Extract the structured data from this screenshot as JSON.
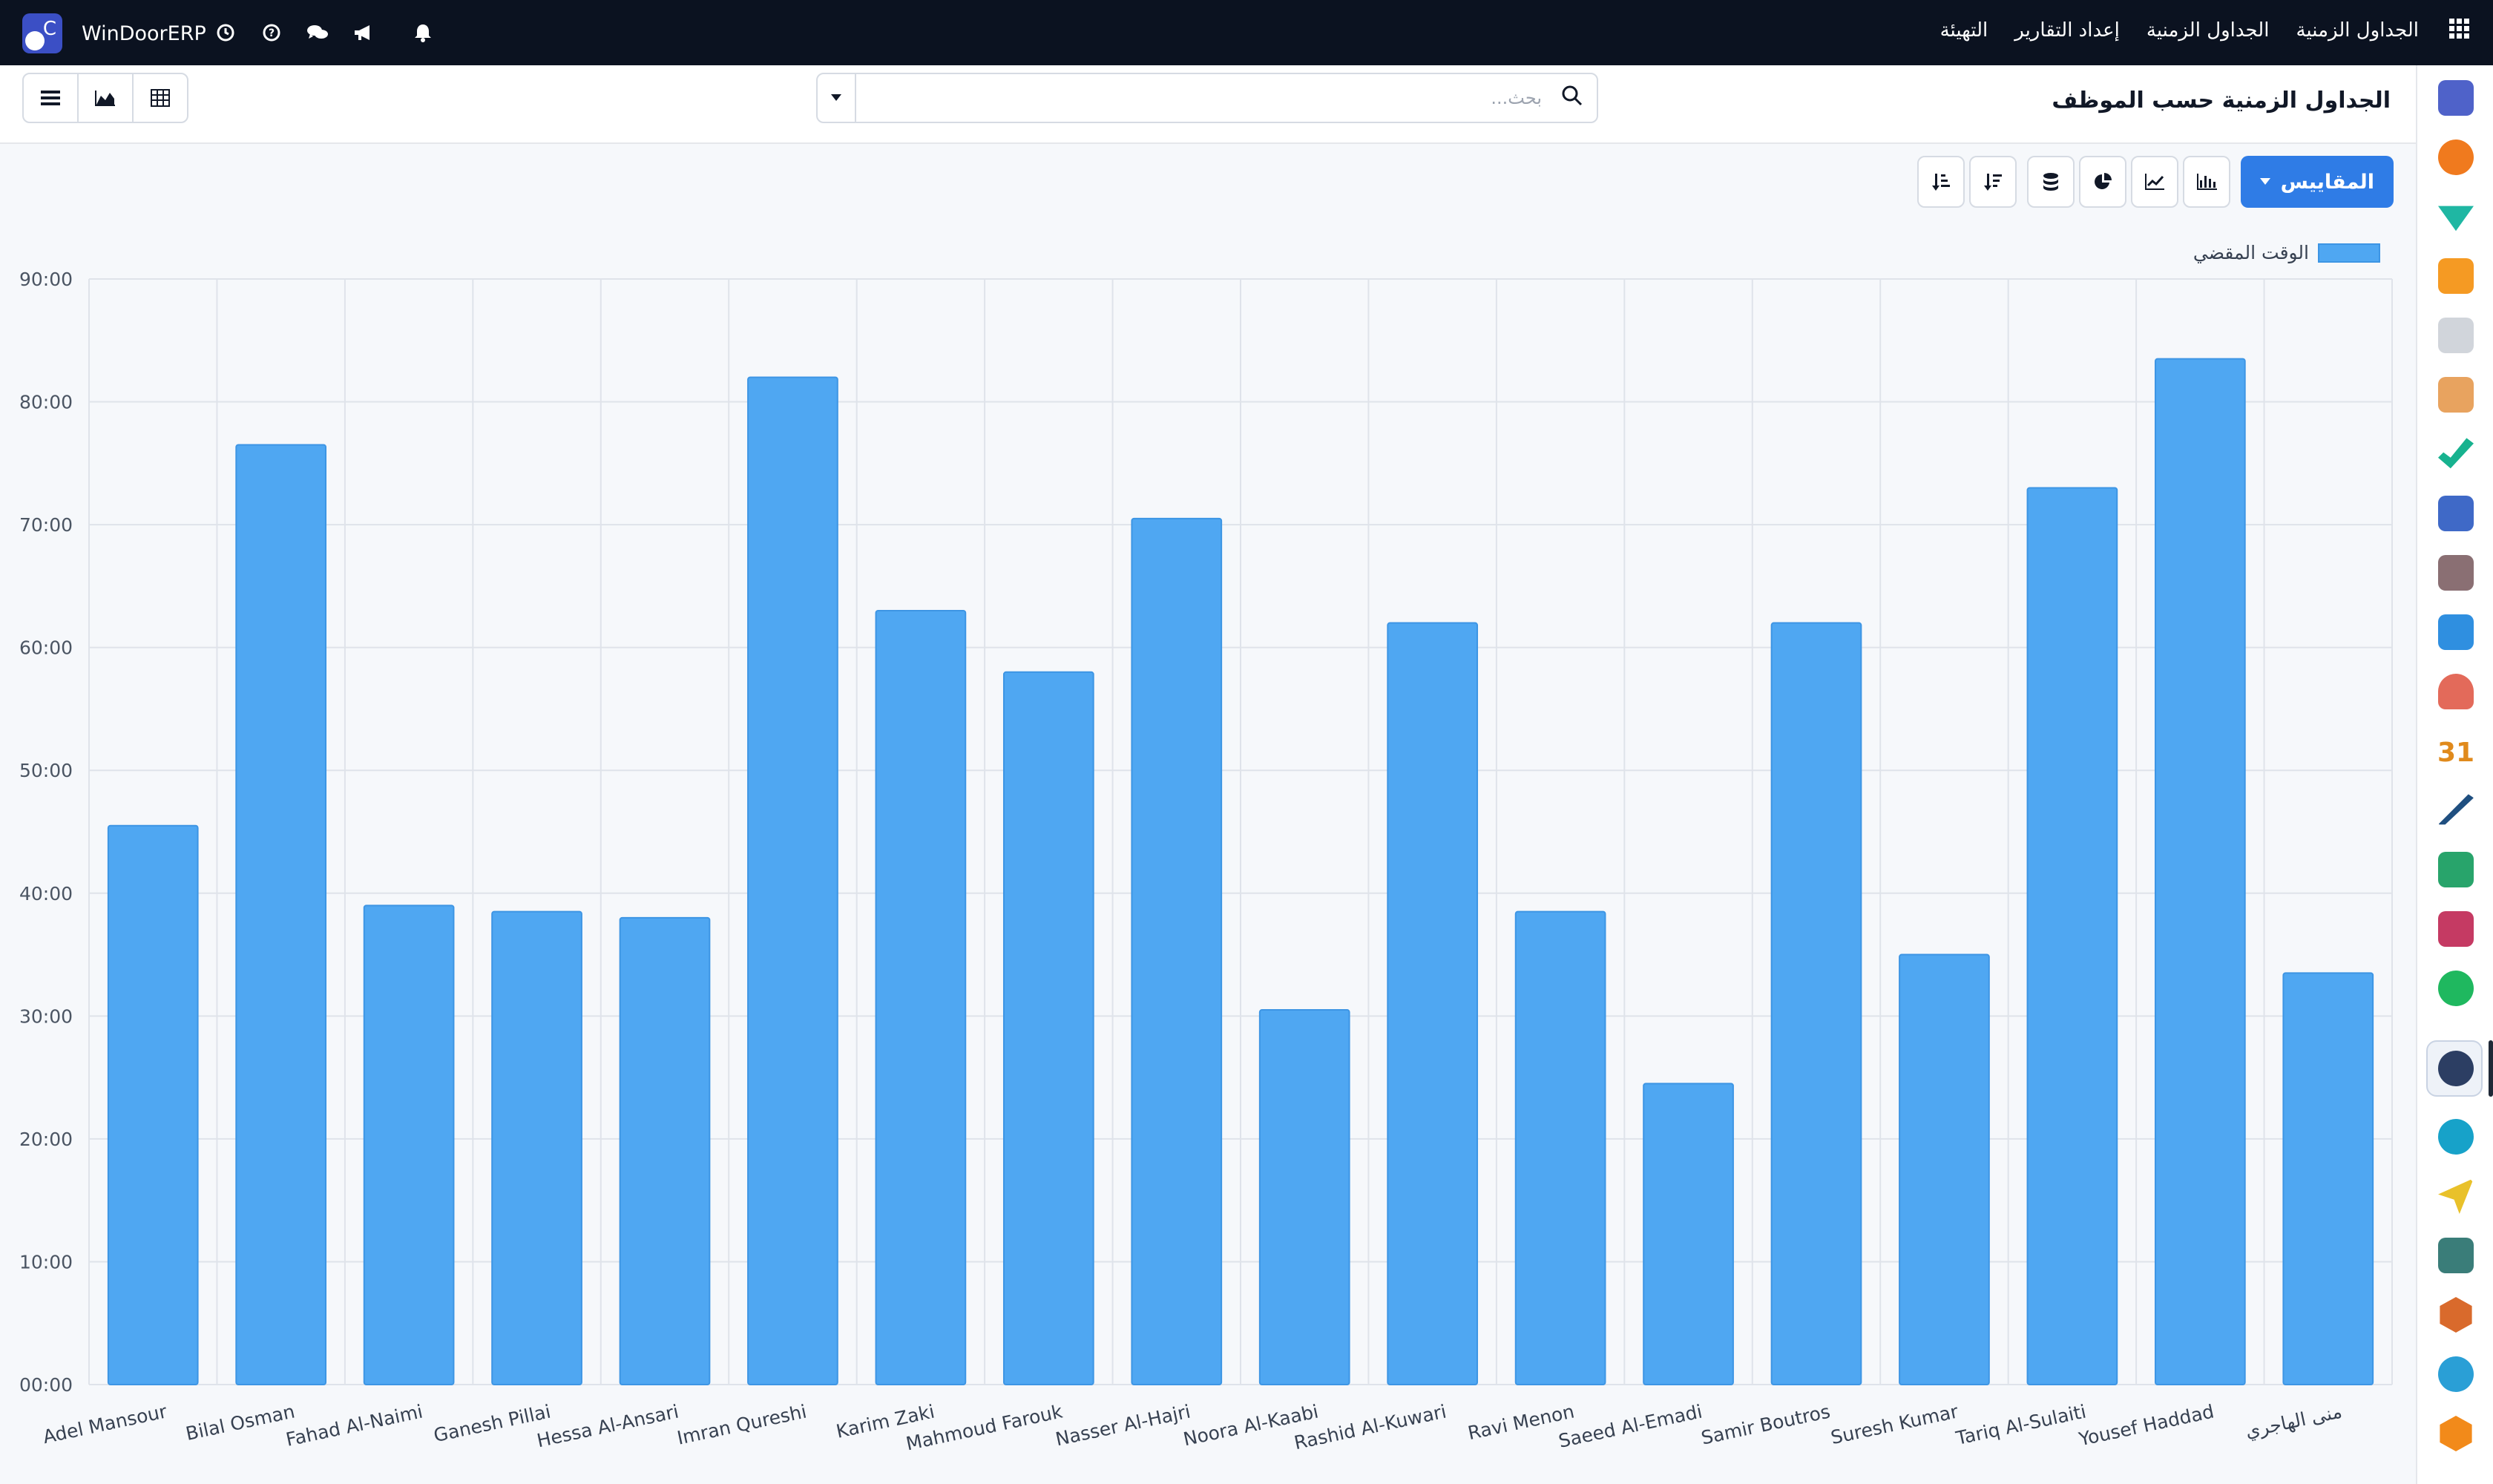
{
  "navbar": {
    "brand": "WinDoorERP",
    "menu": [
      "الجداول الزمنية",
      "الجداول الزمنية",
      "إعداد التقارير",
      "التهيئة"
    ]
  },
  "control_panel": {
    "title": "الجداول الزمنية حسب الموظف",
    "search_placeholder": "بحث..."
  },
  "toolbar": {
    "measures_label": "المقاييس"
  },
  "colors": {
    "navbar_bg": "#0b1220",
    "bar": "#4fa7f2",
    "primary": "#2f7ce6"
  },
  "chart_data": {
    "type": "bar",
    "series": [
      {
        "name": "الوقت المقضي",
        "values": [
          45.5,
          76.5,
          39.0,
          38.5,
          38.0,
          82.0,
          63.0,
          58.0,
          70.5,
          30.5,
          62.0,
          38.5,
          24.5,
          62.0,
          35.0,
          73.0,
          83.5,
          33.5
        ]
      }
    ],
    "categories": [
      "Adel Mansour",
      "Bilal Osman",
      "Fahad Al-Naimi",
      "Ganesh Pillai",
      "Hessa Al-Ansari",
      "Imran Qureshi",
      "Karim Zaki",
      "Mahmoud Farouk",
      "Nasser Al-Hajri",
      "Noora Al-Kaabi",
      "Rashid Al-Kuwari",
      "Ravi Menon",
      "Saeed Al-Emadi",
      "Samir Boutros",
      "Suresh Kumar",
      "Tariq Al-Sulaiti",
      "Yousef Haddad",
      "منى الهاجري"
    ],
    "y_tick_labels": [
      "00:00",
      "10:00",
      "20:00",
      "30:00",
      "40:00",
      "50:00",
      "60:00",
      "70:00",
      "80:00",
      "90:00"
    ],
    "ylim": [
      0,
      90
    ],
    "grid": true,
    "legend_position": "top-right"
  }
}
